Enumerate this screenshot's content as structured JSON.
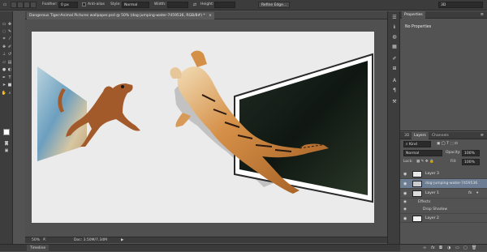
{
  "options_bar": {
    "feather_label": "Feather:",
    "feather_value": "0 px",
    "antialias_label": "Anti-alias",
    "style_label": "Style:",
    "style_value": "Normal",
    "width_label": "Width:",
    "height_label": "Height:",
    "refine_edge_label": "Refine Edge...",
    "workspace_value": "3D"
  },
  "document": {
    "tab_title": "Dangerous Tiger-Animal Pictures wallpaper.psd @ 50% (dog-jumping-water-7459536, RGB/8#) *",
    "zoom": "50%",
    "doc_info": "Doc: 3.50M/7.34M"
  },
  "panels": {
    "properties": {
      "tab_label": "Properties",
      "title": "No Properties"
    },
    "layers": {
      "tabs": [
        "3D",
        "Layers",
        "Channels"
      ],
      "kind_filter": "Kind",
      "blend_mode": "Normal",
      "opacity_label": "Opacity:",
      "opacity_value": "100%",
      "lock_label": "Lock:",
      "fill_label": "Fill:",
      "fill_value": "100%",
      "items": [
        {
          "name": "Layer 3"
        },
        {
          "name": "dog-jumping-water-7459536"
        },
        {
          "name": "Layer 1"
        },
        {
          "name": "Effects"
        },
        {
          "name": "Drop Shadow"
        },
        {
          "name": "Layer 2"
        }
      ],
      "fx_label": "fx"
    }
  },
  "timeline": {
    "tab_label": "Timeline"
  },
  "colors": {
    "chrome_dark": "#3c3c3c",
    "chrome_mid": "#535353",
    "selection": "#6d7e94",
    "canvas_bg": "#ebebeb"
  }
}
